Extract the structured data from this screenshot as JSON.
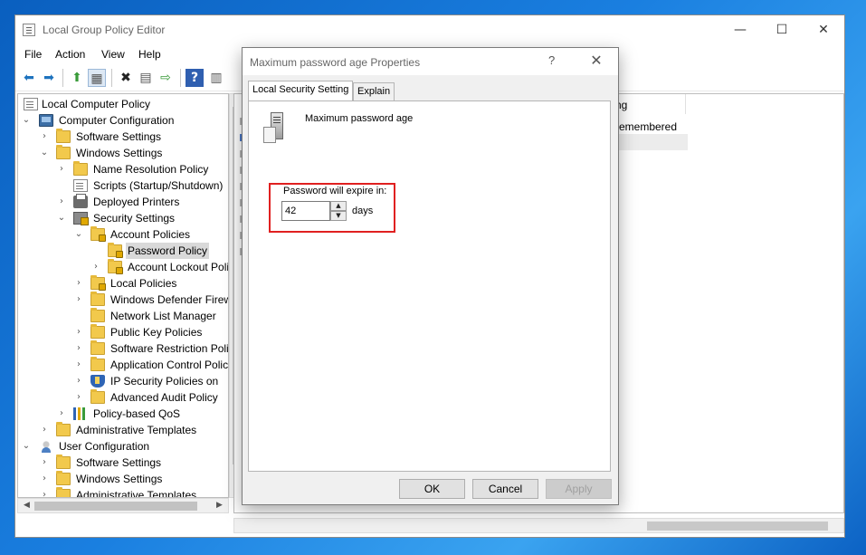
{
  "window": {
    "title": "Local Group Policy Editor",
    "menu": [
      "File",
      "Action",
      "View",
      "Help"
    ],
    "caption": {
      "minimize": "—",
      "maximize": "☐",
      "close": "✕"
    },
    "toolbar": {
      "back": "⬅",
      "forward": "➡",
      "up": "⬆",
      "show_tree": "▦",
      "delete": "✖",
      "properties": "▤",
      "export": "⇨",
      "help": "?",
      "view": "▥"
    }
  },
  "tree": {
    "items": [
      {
        "label": "Local Computer Policy"
      },
      {
        "label": "Computer Configuration"
      },
      {
        "label": "Software Settings"
      },
      {
        "label": "Windows Settings"
      },
      {
        "label": "Name Resolution Policy"
      },
      {
        "label": "Scripts (Startup/Shutdown)"
      },
      {
        "label": "Deployed Printers"
      },
      {
        "label": "Security Settings"
      },
      {
        "label": "Account Policies"
      },
      {
        "label": "Password Policy"
      },
      {
        "label": "Account Lockout Policy"
      },
      {
        "label": "Local Policies"
      },
      {
        "label": "Windows Defender Firewall"
      },
      {
        "label": "Network List Manager"
      },
      {
        "label": "Public Key Policies"
      },
      {
        "label": "Software Restriction Policies"
      },
      {
        "label": "Application Control Policies"
      },
      {
        "label": "IP Security Policies on"
      },
      {
        "label": "Advanced Audit Policy"
      },
      {
        "label": "Policy-based QoS"
      },
      {
        "label": "Administrative Templates"
      },
      {
        "label": "User Configuration"
      },
      {
        "label": "Software Settings"
      },
      {
        "label": "Windows Settings"
      },
      {
        "label": "Administrative Templates"
      }
    ]
  },
  "right_pane": {
    "column_setting": "ng",
    "row_value": "remembered"
  },
  "dialog": {
    "title": "Maximum password age Properties",
    "help": "?",
    "close": "✕",
    "tabs": [
      {
        "label": "Local Security Setting"
      },
      {
        "label": "Explain"
      }
    ],
    "policy_name": "Maximum password age",
    "expire_label": "Password will expire in:",
    "age_value": "42",
    "unit": "days",
    "spin_up": "▲",
    "spin_down": "▼",
    "buttons": {
      "ok": "OK",
      "cancel": "Cancel",
      "apply": "Apply"
    },
    "highlight_color": "#e02020"
  }
}
